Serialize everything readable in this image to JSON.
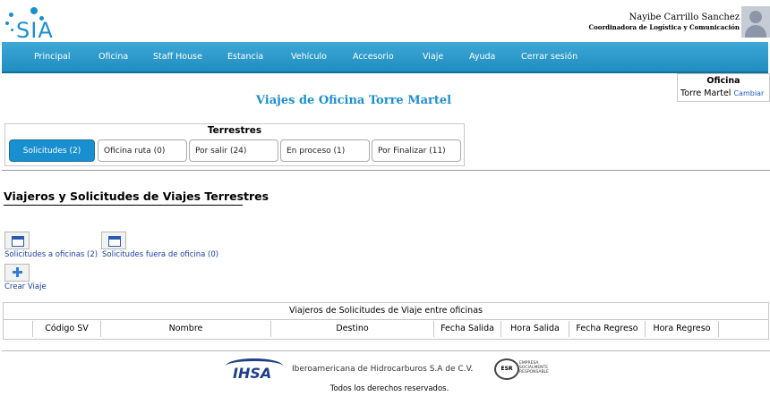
{
  "header": {
    "logo": "SIA",
    "user_name": "Nayibe Carrillo Sanchez",
    "user_role": "Coordinadora de Logística y Comunicación"
  },
  "nav": [
    "Principal",
    "Oficina",
    "Staff House",
    "Estancia",
    "Vehículo",
    "Accesorio",
    "Viaje",
    "Ayuda",
    "Cerrar sesión"
  ],
  "office": {
    "title": "Oficina",
    "value": "Torre Martel",
    "change": "Cambiar"
  },
  "page_title": "Viajes de Oficina Torre Martel",
  "terrestres": {
    "title": "Terrestres",
    "tabs": [
      "Solicitudes (2)",
      "Oficina ruta (0)",
      "Por salir (24)",
      "En proceso (1)",
      "Por Finalizar (11)"
    ]
  },
  "section_title": "Viajeros y Solicitudes de Viajes Terrestres",
  "actions": {
    "solicitudes_oficinas": "Solicitudes a oficinas (2)",
    "solicitudes_fuera": "Solicitudes fuera de oficina (0)",
    "crear_viaje": "Crear Viaje"
  },
  "table": {
    "caption": "Viajeros de Solicitudes de Viaje entre oficinas",
    "columns": [
      "",
      "Código SV",
      "Nombre",
      "Destino",
      "Fecha Salida",
      "Hora Salida",
      "Fecha Regreso",
      "Hora Regreso",
      ""
    ]
  },
  "footer": {
    "company": "Iberoamericana de Hidrocarburos S.A de C.V.",
    "ihsa_logo": "IHSA",
    "esr_logo": "ESR",
    "esr_text": [
      "EMPRESA",
      "SOCIALMENTE",
      "RESPONSABLE"
    ],
    "copyright": "Todos los derechos reservados."
  }
}
